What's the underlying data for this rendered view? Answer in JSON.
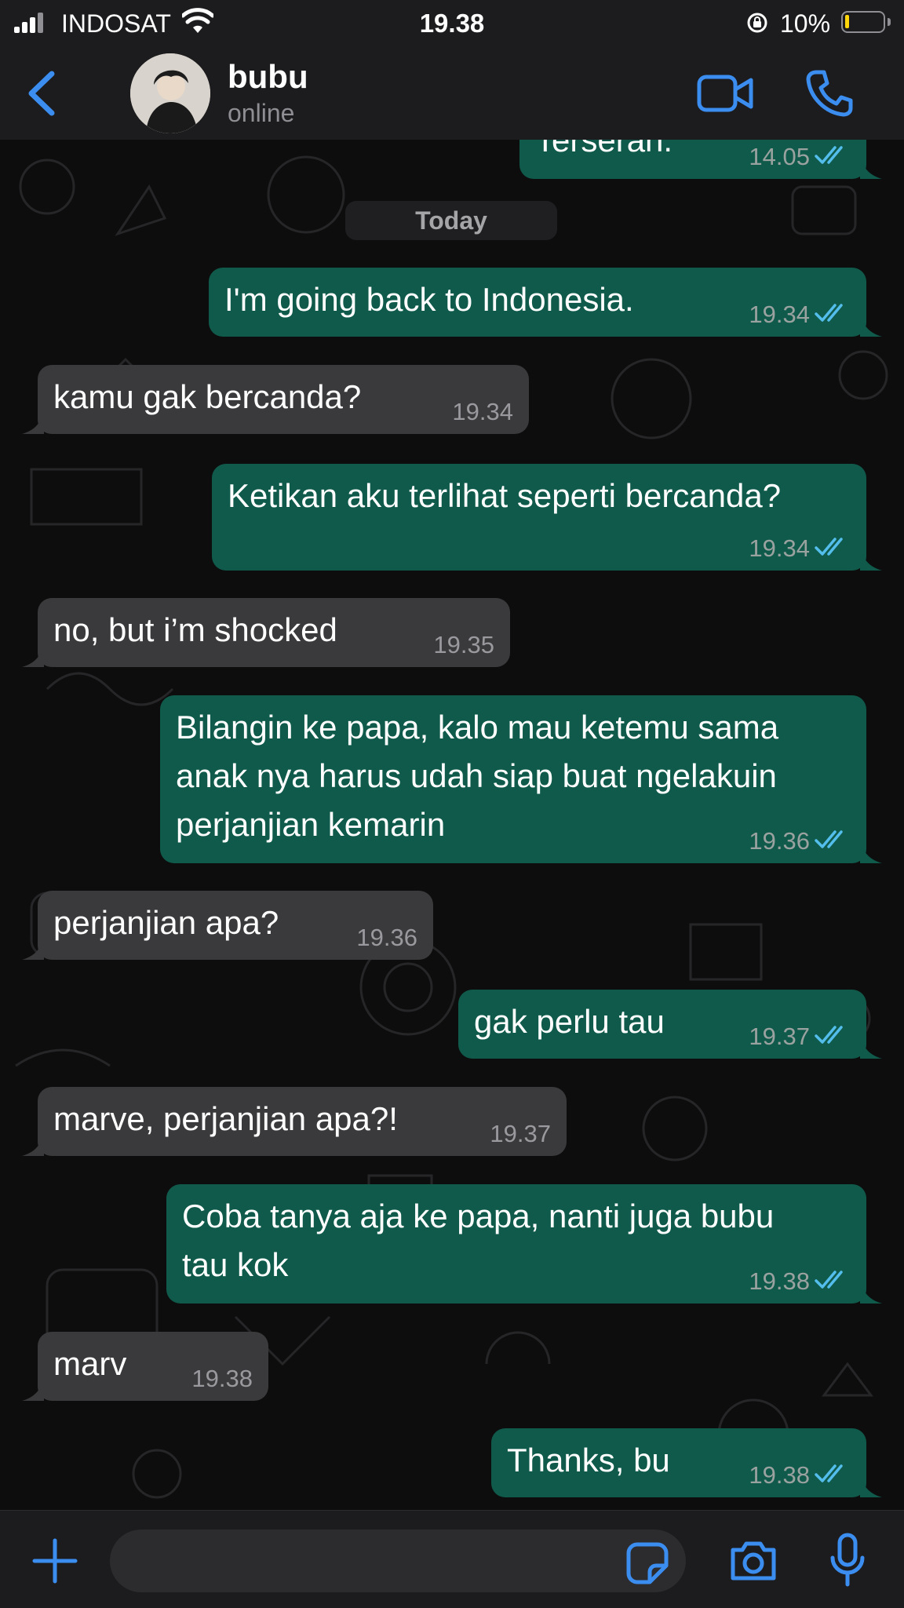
{
  "status_bar": {
    "carrier": "INDOSAT",
    "time": "19.38",
    "battery": "10%",
    "battery_level": 0.1
  },
  "header": {
    "contact_name": "bubu",
    "presence": "online"
  },
  "chat": {
    "date_separator": "Today",
    "messages": [
      {
        "dir": "out",
        "lines": [
          "Terserah."
        ],
        "time": "14.05",
        "read": true
      },
      {
        "dir": "out",
        "lines": [
          "I'm going back to Indonesia."
        ],
        "time": "19.34",
        "read": true
      },
      {
        "dir": "in",
        "lines": [
          "kamu gak bercanda?"
        ],
        "time": "19.34"
      },
      {
        "dir": "out",
        "lines": [
          "Ketikan aku terlihat seperti bercanda?"
        ],
        "time": "19.34",
        "read": true
      },
      {
        "dir": "in",
        "lines": [
          "no, but i’m shocked"
        ],
        "time": "19.35"
      },
      {
        "dir": "out",
        "lines": [
          "Bilangin ke papa, kalo mau ketemu sama",
          "anak nya harus udah siap buat ngelakuin",
          "perjanjian kemarin"
        ],
        "time": "19.36",
        "read": true
      },
      {
        "dir": "in",
        "lines": [
          "perjanjian apa?"
        ],
        "time": "19.36"
      },
      {
        "dir": "out",
        "lines": [
          "gak perlu tau"
        ],
        "time": "19.37",
        "read": true
      },
      {
        "dir": "in",
        "lines": [
          "marve, perjanjian apa?!"
        ],
        "time": "19.37"
      },
      {
        "dir": "out",
        "lines": [
          "Coba tanya aja ke papa, nanti juga bubu",
          "tau kok"
        ],
        "time": "19.38",
        "read": true
      },
      {
        "dir": "in",
        "lines": [
          "marv"
        ],
        "time": "19.38"
      },
      {
        "dir": "out",
        "lines": [
          "Thanks, bu"
        ],
        "time": "19.38",
        "read": true
      }
    ]
  },
  "composer": {
    "placeholder": ""
  },
  "colors": {
    "accent": "#3b8ef0",
    "outgoing_bubble": "#105a4b",
    "incoming_bubble": "#3a3a3c",
    "read_ticks": "#53bdeb"
  }
}
